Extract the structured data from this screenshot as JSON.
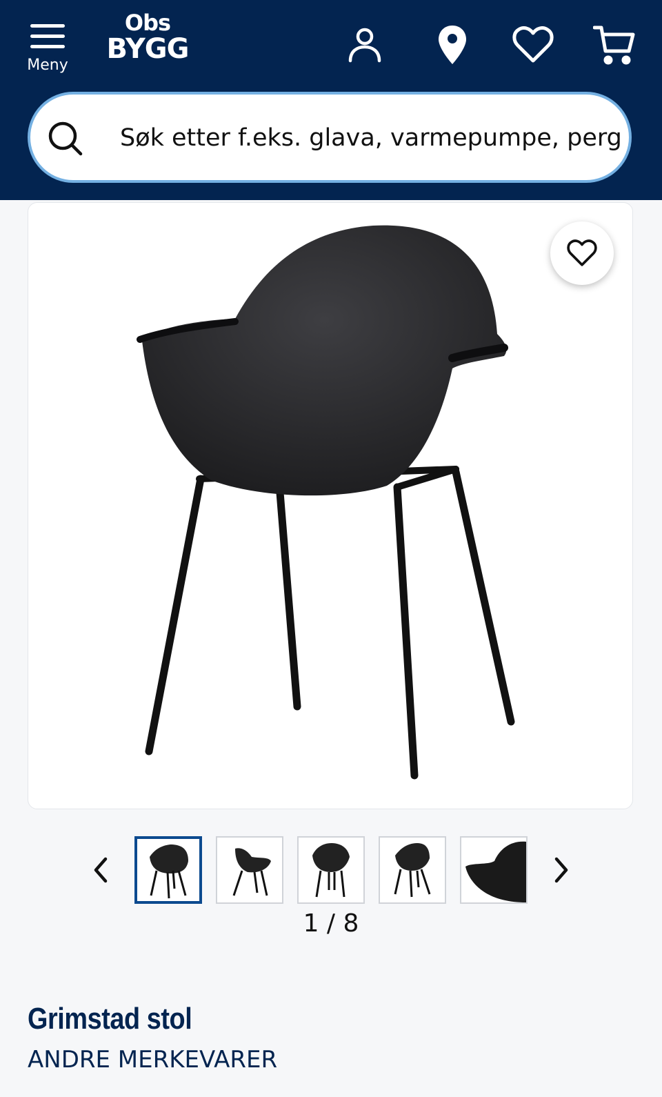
{
  "header": {
    "menu_label": "Meny",
    "logo_top": "Obs",
    "logo_bottom": "BYGG",
    "icons": [
      "user-icon",
      "location-pin-icon",
      "heart-icon",
      "cart-icon"
    ],
    "background": "#032450"
  },
  "search": {
    "placeholder": "Søk etter f.eks. glava, varmepumpe, perg",
    "border_color": "#74b0e2"
  },
  "gallery": {
    "current": 1,
    "total": 8,
    "counter_text": "1 / 8",
    "visible_thumbnails": 5,
    "active_border_color": "#0c4a8f"
  },
  "product": {
    "title": "Grimstad stol",
    "brand": "ANDRE MERKEVARER",
    "title_color": "#032450"
  }
}
